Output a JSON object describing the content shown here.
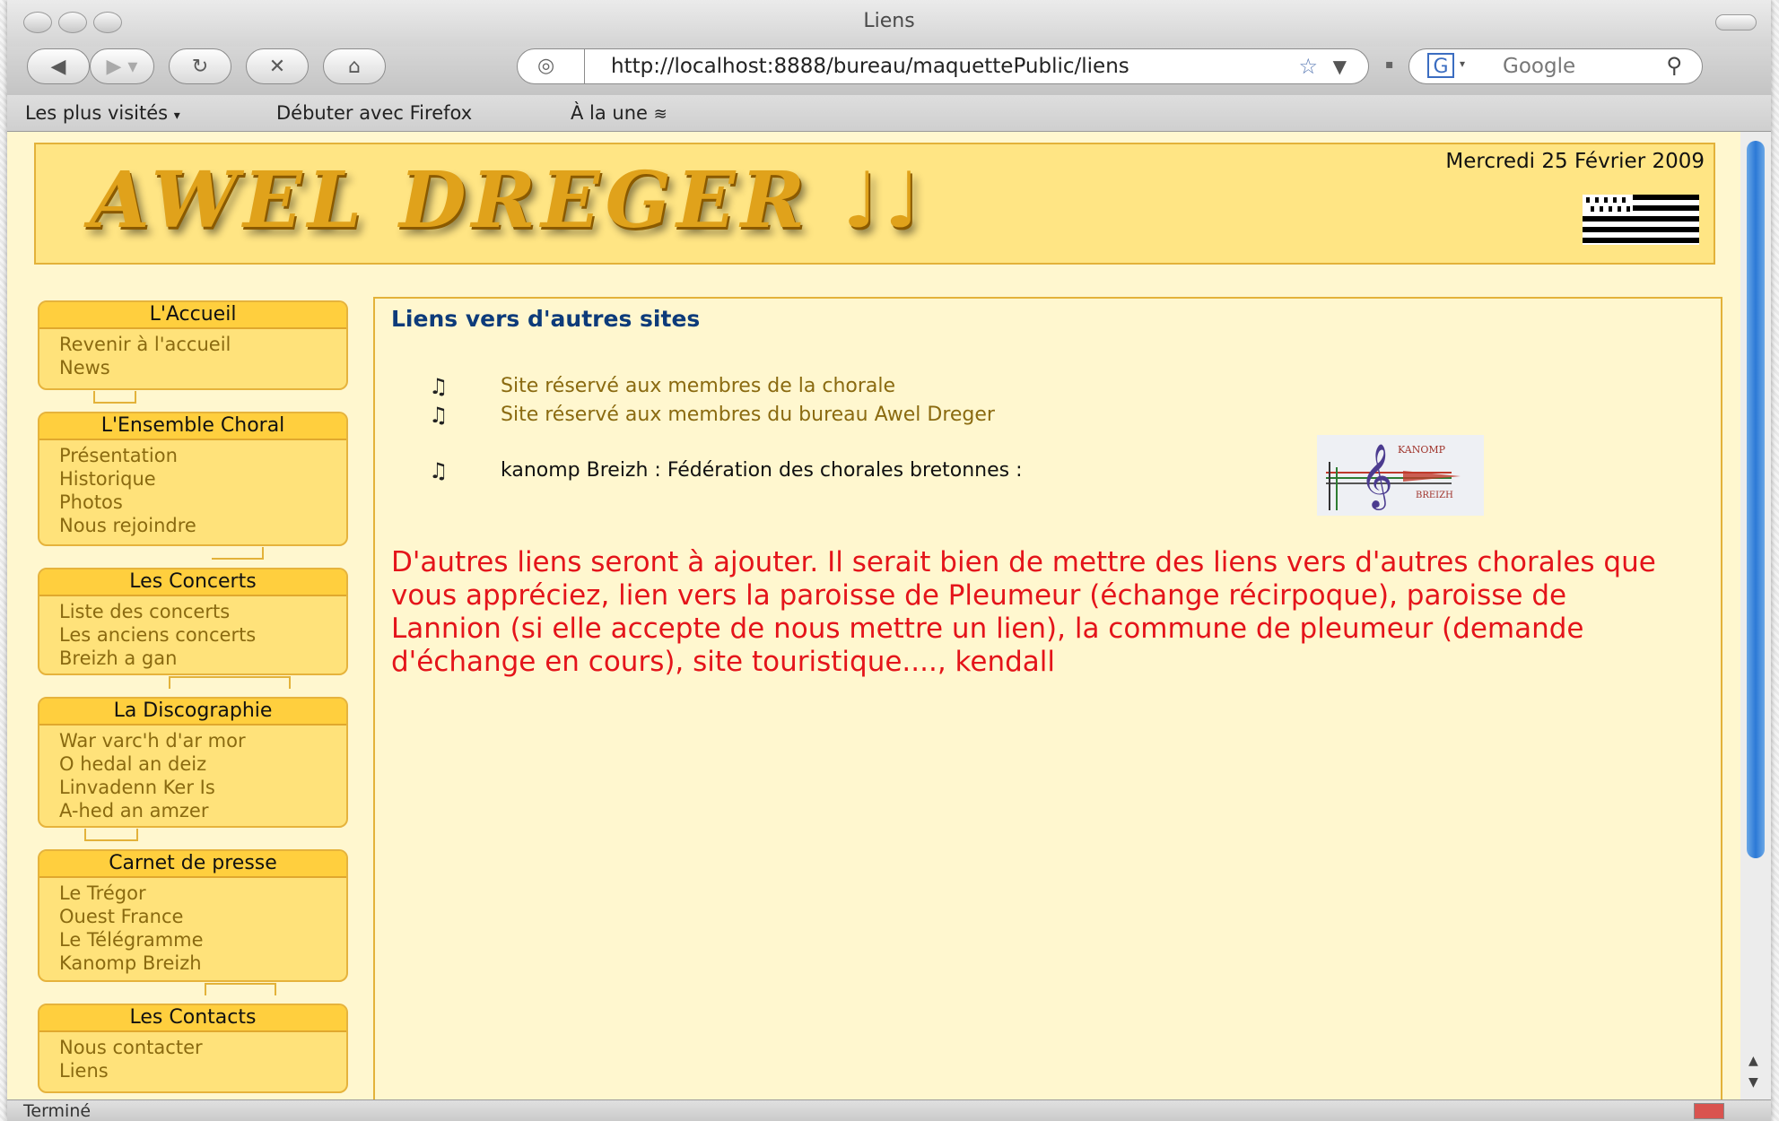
{
  "window": {
    "title": "Liens"
  },
  "toolbar": {
    "url": "http://localhost:8888/bureau/maquettePublic/liens",
    "search_placeholder": "Google"
  },
  "bookmarks": {
    "items": [
      "Les plus visités",
      "Débuter avec Firefox",
      "À la une"
    ]
  },
  "status": {
    "text": "Terminé"
  },
  "header": {
    "logo_text": "AWEL DREGER",
    "date": "Mercredi 25 Février 2009"
  },
  "menus": {
    "accueil": {
      "title": "L'Accueil",
      "links": [
        "Revenir à l'accueil",
        "News"
      ]
    },
    "ensemble": {
      "title": "L'Ensemble Choral",
      "links": [
        "Présentation",
        "Historique",
        "Photos",
        "Nous rejoindre"
      ]
    },
    "concerts": {
      "title": "Les Concerts",
      "links": [
        "Liste des concerts",
        "Les anciens concerts",
        "Breizh a gan"
      ]
    },
    "discographie": {
      "title": "La Discographie",
      "links": [
        "War varc'h d'ar mor",
        "O hedal an deiz",
        "Linvadenn Ker Is",
        "A-hed an amzer"
      ]
    },
    "presse": {
      "title": "Carnet de presse",
      "links": [
        "Le Trégor",
        "Ouest France",
        "Le Télégramme",
        "Kanomp Breizh"
      ]
    },
    "contacts": {
      "title": "Les Contacts",
      "links": [
        "Nous contacter",
        "Liens"
      ]
    }
  },
  "content": {
    "title": "Liens vers d'autres sites",
    "links": [
      "Site réservé aux membres de la chorale",
      "Site réservé aux membres du bureau Awel Dreger"
    ],
    "federation": "kanomp Breizh : Fédération des chorales bretonnes :",
    "kanomp_logo": {
      "top": "KANOMP",
      "bottom": "BREIZH"
    },
    "note": "D'autres liens seront à ajouter. Il serait bien de mettre des liens vers d'autres chorales que vous appréciez, lien vers la paroisse de Pleumeur (échange récirpoque), paroisse de Lannion (si elle accepte de nous mettre un lien), la commune de pleumeur (demande d'échange en cours), site touristique...., kendall"
  },
  "colors": {
    "header_bg": "#ffe584",
    "menu_title_bg": "#ffcf3e",
    "title_blue": "#0d3b7a",
    "note_red": "#e4141a",
    "link_brown": "#8a6a10"
  }
}
